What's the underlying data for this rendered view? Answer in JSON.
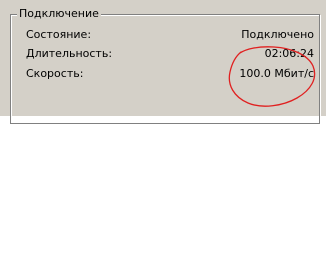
{
  "connection": {
    "group_title": "Подключение",
    "rows": [
      {
        "label": "Состояние:",
        "value": "Подключено"
      },
      {
        "label": "Длительность:",
        "value": "02:06:24"
      },
      {
        "label": "Скорость:",
        "value": "100.0 Мбит/с"
      }
    ]
  },
  "colors": {
    "dialog_background": "#d4d0c8",
    "annotation_stroke": "#e02020"
  }
}
